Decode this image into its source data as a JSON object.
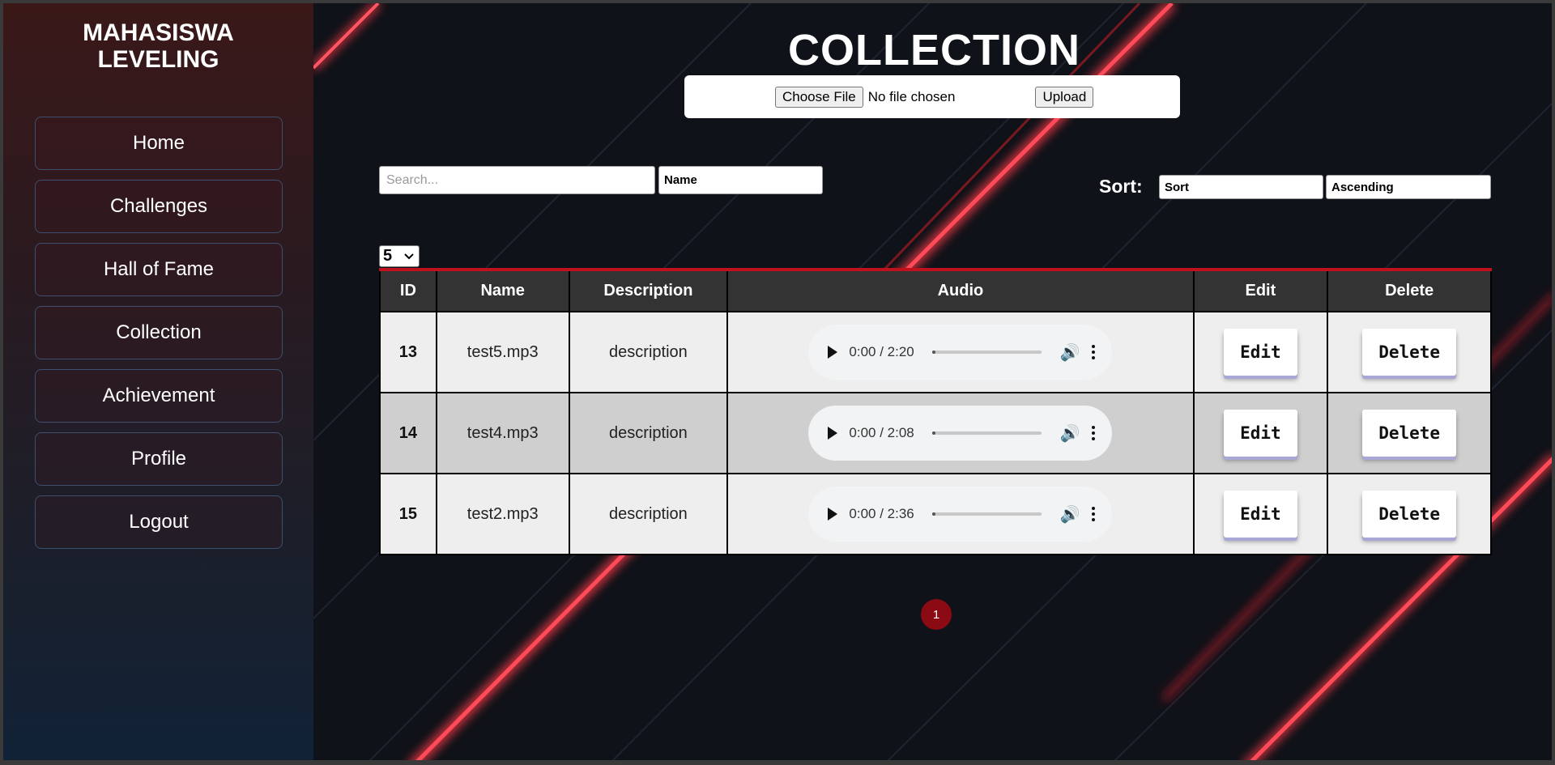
{
  "sidebar": {
    "brand_line1": "MAHASISWA",
    "brand_line2": "LEVELING",
    "items": [
      {
        "label": "Home"
      },
      {
        "label": "Challenges"
      },
      {
        "label": "Hall of Fame"
      },
      {
        "label": "Collection"
      },
      {
        "label": "Achievement"
      },
      {
        "label": "Profile"
      },
      {
        "label": "Logout"
      }
    ]
  },
  "main": {
    "title": "COLLECTION",
    "upload": {
      "choose_label": "Choose File",
      "file_status": "No file chosen",
      "upload_label": "Upload"
    },
    "search": {
      "placeholder": "Search...",
      "field": "Name"
    },
    "sort": {
      "label": "Sort:",
      "by": "Sort",
      "order": "Ascending"
    },
    "rows_per_page": "5",
    "table": {
      "headers": [
        "ID",
        "Name",
        "Description",
        "Audio",
        "Edit",
        "Delete"
      ],
      "rows": [
        {
          "id": "13",
          "name": "test5.mp3",
          "description": "description",
          "audio_time": "0:00 / 2:20",
          "edit": "Edit",
          "delete": "Delete"
        },
        {
          "id": "14",
          "name": "test4.mp3",
          "description": "description",
          "audio_time": "0:00 / 2:08",
          "edit": "Edit",
          "delete": "Delete"
        },
        {
          "id": "15",
          "name": "test2.mp3",
          "description": "description",
          "audio_time": "0:00 / 2:36",
          "edit": "Edit",
          "delete": "Delete"
        }
      ]
    },
    "pagination": {
      "current": "1"
    }
  },
  "colors": {
    "accent_red": "#c0121c",
    "pager_red": "#8b0a14",
    "header_bg": "#333333"
  },
  "icons": [
    "play-icon",
    "volume-icon",
    "more-options-icon",
    "chevron-down-icon"
  ]
}
